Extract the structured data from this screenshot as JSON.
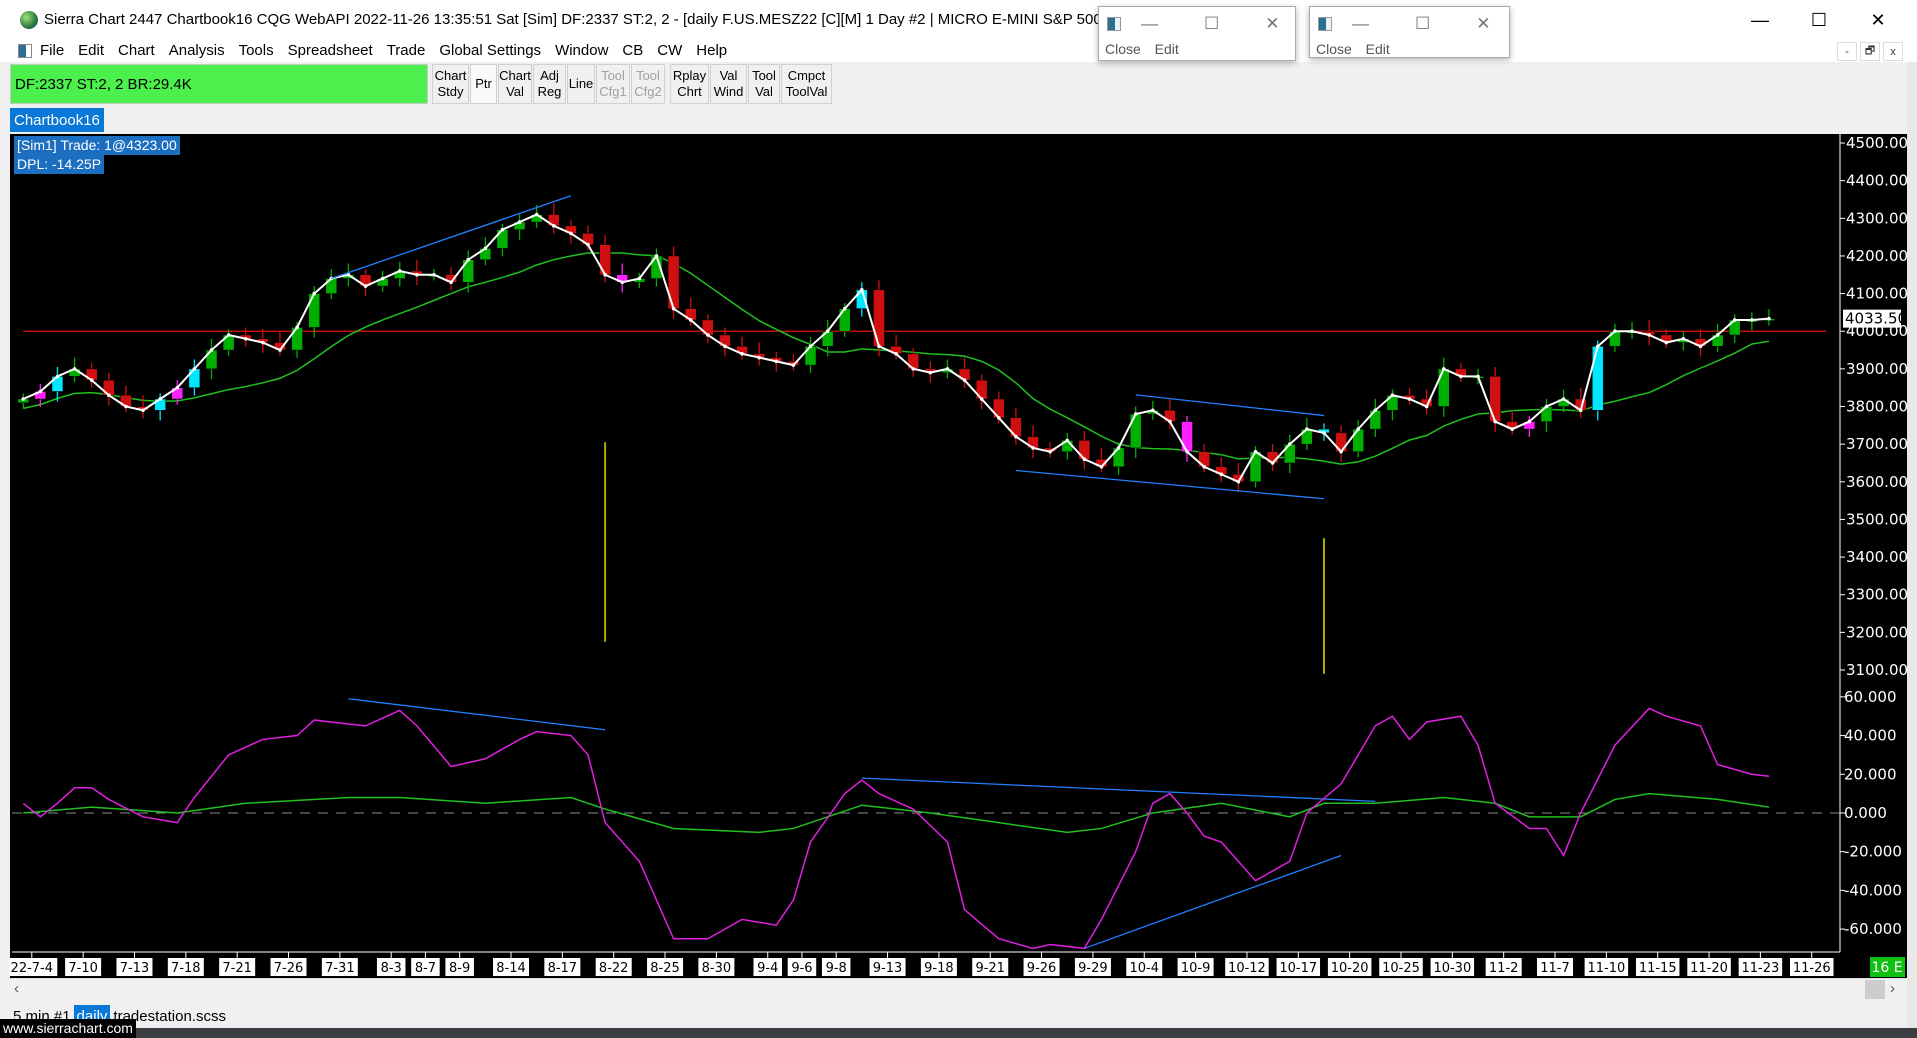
{
  "window": {
    "title": "Sierra Chart 2447 Chartbook16  CQG WebAPI 2022-11-26  13:35:51 Sat [Sim]  DF:2337  ST:2, 2 - [daily F.US.MESZ22 [C][M]  1 Day   #2 | MICRO E-MINI S&P 500 F",
    "minimize": "—",
    "maximize": "☐",
    "close": "✕"
  },
  "menu": [
    "File",
    "Edit",
    "Chart",
    "Analysis",
    "Tools",
    "Spreadsheet",
    "Trade",
    "Global Settings",
    "Window",
    "CB",
    "CW",
    "Help"
  ],
  "mdi_buttons": [
    "-",
    "🗗",
    "x"
  ],
  "floating_windows": [
    {
      "label": "Close   Edit"
    },
    {
      "label": "Close   Edit"
    }
  ],
  "toolbar": {
    "status": "DF:2337  ST:2, 2  BR:29.4K",
    "buttons": [
      {
        "label": "Chart\nStdy",
        "enabled": true
      },
      {
        "label": "Ptr",
        "enabled": true
      },
      {
        "label": "Chart\nVal",
        "enabled": true
      },
      {
        "label": "Adj\nReg",
        "enabled": true
      },
      {
        "label": "Line",
        "enabled": true
      },
      {
        "label": "Tool\nCfg1",
        "enabled": false
      },
      {
        "label": "Tool\nCfg2",
        "enabled": false
      },
      {
        "label": "Rplay\nChrt",
        "enabled": true
      },
      {
        "label": "Val\nWind",
        "enabled": true
      },
      {
        "label": "Tool\nVal",
        "enabled": true
      },
      {
        "label": "Cmpct\nToolVal",
        "enabled": true
      }
    ]
  },
  "chartbook_tab": "Chartbook16",
  "trade_info": {
    "sim": "[Sim1]  Trade: 1@4323.00",
    "dpl": "DPL: -14.25P"
  },
  "sheet_tabs": [
    {
      "label": "5 min #1",
      "active": false
    },
    {
      "label": "daily",
      "active": true
    },
    {
      "label": "tradestation.scss",
      "active": false
    }
  ],
  "website": "www.sierrachart.com",
  "bars_indicator": "16 E",
  "colors": {
    "up": "#00b000",
    "down": "#d01010",
    "ma": "#20c020",
    "line": "#ffffff",
    "osc": "#e020e0",
    "osc_signal": "#20c020",
    "trend": "#2080ff",
    "hline": "#c01010",
    "highlight_up": "#00e8ff",
    "highlight_down": "#ff20ff",
    "spike": "#b0b000"
  },
  "chart_data": {
    "type": "candlestick",
    "symbol": "F.US.MESZ22",
    "current_price": "4033.50",
    "price_axis": {
      "ylim": [
        3100,
        4500
      ],
      "ticks": [
        "4500.00",
        "4400.00",
        "4300.00",
        "4200.00",
        "4100.00",
        "4000.00",
        "3900.00",
        "3800.00",
        "3700.00",
        "3600.00",
        "3500.00",
        "3400.00",
        "3300.00",
        "3200.00",
        "3100.00"
      ]
    },
    "closes": [
      3820,
      3840,
      3880,
      3900,
      3870,
      3830,
      3800,
      3790,
      3820,
      3850,
      3900,
      3950,
      3990,
      3980,
      3970,
      3950,
      4010,
      4100,
      4140,
      4150,
      4120,
      4140,
      4160,
      4150,
      4150,
      4130,
      4190,
      4220,
      4270,
      4290,
      4310,
      4280,
      4260,
      4230,
      4150,
      4130,
      4140,
      4200,
      4060,
      4030,
      3990,
      3960,
      3940,
      3930,
      3920,
      3910,
      3960,
      4000,
      4060,
      4110,
      3960,
      3940,
      3900,
      3890,
      3900,
      3870,
      3820,
      3770,
      3720,
      3690,
      3680,
      3710,
      3660,
      3640,
      3690,
      3780,
      3790,
      3760,
      3680,
      3640,
      3620,
      3600,
      3680,
      3650,
      3700,
      3740,
      3730,
      3680,
      3740,
      3790,
      3830,
      3820,
      3800,
      3900,
      3880,
      3880,
      3760,
      3740,
      3760,
      3800,
      3820,
      3790,
      3960,
      4000,
      4000,
      3990,
      3970,
      3980,
      3960,
      3990,
      4030,
      4030,
      4033.5
    ],
    "highlight_up_bars": [
      2,
      8,
      10,
      49,
      76,
      92
    ],
    "highlight_down_bars": [
      1,
      9,
      35,
      68,
      88
    ],
    "horizontal_line": 4000,
    "spikes": [
      {
        "bar": 34,
        "from": 3705,
        "to": 3175
      },
      {
        "bar": 76,
        "from": 3450,
        "to": 3090
      }
    ],
    "price_trendlines": [
      {
        "bar1": 18,
        "p1": 4140,
        "bar2": 32,
        "p2": 4360
      },
      {
        "bar1": 58,
        "p1": 3630,
        "bar2": 76,
        "p2": 3555
      },
      {
        "bar1": 65,
        "p1": 3831,
        "bar2": 76,
        "p2": 3776
      }
    ],
    "osc_axis": {
      "ylim": [
        -70,
        70
      ],
      "ticks": [
        "60.000",
        "40.000",
        "20.000",
        "0.000",
        "-20.000",
        "-40.000",
        "-60.000"
      ]
    },
    "oscillator": [
      [
        0,
        5
      ],
      [
        1,
        -2
      ],
      [
        2,
        5
      ],
      [
        3,
        13
      ],
      [
        4,
        13
      ],
      [
        5,
        7
      ],
      [
        7,
        -2
      ],
      [
        9,
        -5
      ],
      [
        10,
        8
      ],
      [
        12,
        30
      ],
      [
        14,
        38
      ],
      [
        16,
        40
      ],
      [
        17,
        48
      ],
      [
        19,
        46
      ],
      [
        20,
        45
      ],
      [
        22,
        53
      ],
      [
        23,
        45
      ],
      [
        25,
        24
      ],
      [
        27,
        28
      ],
      [
        29,
        38
      ],
      [
        30,
        42
      ],
      [
        32,
        40
      ],
      [
        33,
        30
      ],
      [
        34,
        -5
      ],
      [
        36,
        -25
      ],
      [
        37,
        -45
      ],
      [
        38,
        -65
      ],
      [
        40,
        -65
      ],
      [
        42,
        -55
      ],
      [
        44,
        -58
      ],
      [
        45,
        -45
      ],
      [
        46,
        -15
      ],
      [
        48,
        10
      ],
      [
        49,
        17
      ],
      [
        50,
        10
      ],
      [
        52,
        2
      ],
      [
        54,
        -15
      ],
      [
        55,
        -50
      ],
      [
        57,
        -65
      ],
      [
        59,
        -70
      ],
      [
        60,
        -68
      ],
      [
        62,
        -70
      ],
      [
        63,
        -55
      ],
      [
        65,
        -20
      ],
      [
        66,
        5
      ],
      [
        67,
        10
      ],
      [
        68,
        0
      ],
      [
        69,
        -12
      ],
      [
        70,
        -15
      ],
      [
        71,
        -25
      ],
      [
        72,
        -35
      ],
      [
        74,
        -25
      ],
      [
        75,
        0
      ],
      [
        77,
        15
      ],
      [
        78,
        30
      ],
      [
        79,
        45
      ],
      [
        80,
        50
      ],
      [
        81,
        38
      ],
      [
        82,
        47
      ],
      [
        84,
        50
      ],
      [
        85,
        35
      ],
      [
        86,
        5
      ],
      [
        88,
        -8
      ],
      [
        89,
        -8
      ],
      [
        90,
        -22
      ],
      [
        91,
        0
      ],
      [
        93,
        35
      ],
      [
        95,
        54
      ],
      [
        96,
        50
      ],
      [
        98,
        45
      ],
      [
        99,
        25
      ],
      [
        101,
        20
      ],
      [
        102,
        19
      ]
    ],
    "oscillator_signal": [
      [
        0,
        0
      ],
      [
        4,
        3
      ],
      [
        9,
        0
      ],
      [
        13,
        5
      ],
      [
        19,
        8
      ],
      [
        22,
        8
      ],
      [
        27,
        5
      ],
      [
        32,
        8
      ],
      [
        34,
        2
      ],
      [
        38,
        -8
      ],
      [
        43,
        -10
      ],
      [
        45,
        -8
      ],
      [
        49,
        4
      ],
      [
        53,
        0
      ],
      [
        57,
        -5
      ],
      [
        61,
        -10
      ],
      [
        63,
        -8
      ],
      [
        66,
        0
      ],
      [
        70,
        5
      ],
      [
        74,
        -2
      ],
      [
        76,
        5
      ],
      [
        79,
        5
      ],
      [
        83,
        8
      ],
      [
        86,
        5
      ],
      [
        88,
        -2
      ],
      [
        91,
        -2
      ],
      [
        93,
        7
      ],
      [
        95,
        10
      ],
      [
        99,
        7
      ],
      [
        102,
        3
      ]
    ],
    "osc_trendlines": [
      {
        "bar1": 19,
        "v1": 59,
        "bar2": 34,
        "v2": 43
      },
      {
        "bar1": 49,
        "v1": 18,
        "bar2": 79,
        "v2": 6
      },
      {
        "bar1": 62,
        "v1": -70,
        "bar2": 77,
        "v2": -22
      }
    ],
    "date_labels": [
      {
        "t": "22-7-4",
        "bar": 0
      },
      {
        "t": "7-10",
        "bar": 3
      },
      {
        "t": "7-13",
        "bar": 6
      },
      {
        "t": "7-18",
        "bar": 9
      },
      {
        "t": "7-21",
        "bar": 12
      },
      {
        "t": "7-26",
        "bar": 15
      },
      {
        "t": "7-31",
        "bar": 18
      },
      {
        "t": "8-3",
        "bar": 21
      },
      {
        "t": "8-7",
        "bar": 23
      },
      {
        "t": "8-9",
        "bar": 25
      },
      {
        "t": "8-14",
        "bar": 28
      },
      {
        "t": "8-17",
        "bar": 31
      },
      {
        "t": "8-22",
        "bar": 34
      },
      {
        "t": "8-25",
        "bar": 37
      },
      {
        "t": "8-30",
        "bar": 40
      },
      {
        "t": "9-4",
        "bar": 43
      },
      {
        "t": "9-6",
        "bar": 45
      },
      {
        "t": "9-8",
        "bar": 47
      },
      {
        "t": "9-13",
        "bar": 50
      },
      {
        "t": "9-18",
        "bar": 53
      },
      {
        "t": "9-21",
        "bar": 56
      },
      {
        "t": "9-26",
        "bar": 59
      },
      {
        "t": "9-29",
        "bar": 62
      },
      {
        "t": "10-4",
        "bar": 65
      },
      {
        "t": "10-9",
        "bar": 68
      },
      {
        "t": "10-12",
        "bar": 71
      },
      {
        "t": "10-17",
        "bar": 74
      },
      {
        "t": "10-20",
        "bar": 77
      },
      {
        "t": "10-25",
        "bar": 80
      },
      {
        "t": "10-30",
        "bar": 83
      },
      {
        "t": "11-2",
        "bar": 86
      },
      {
        "t": "11-7",
        "bar": 89
      },
      {
        "t": "11-10",
        "bar": 92
      },
      {
        "t": "11-15",
        "bar": 95
      },
      {
        "t": "11-20",
        "bar": 98
      },
      {
        "t": "11-23",
        "bar": 101
      },
      {
        "t": "11-26",
        "bar": 104
      }
    ]
  }
}
